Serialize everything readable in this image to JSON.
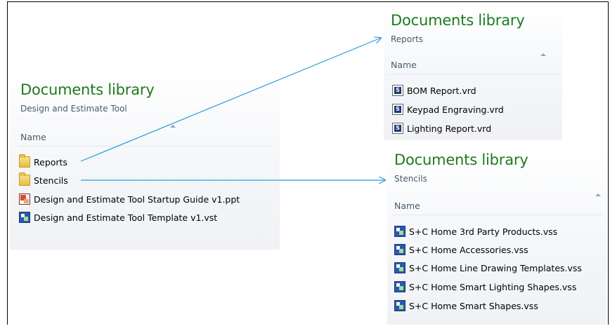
{
  "panels": {
    "main": {
      "title": "Documents library",
      "subtitle": "Design and Estimate Tool",
      "column": "Name",
      "items": [
        {
          "name": "Reports",
          "icon": "folder-icon"
        },
        {
          "name": "Stencils",
          "icon": "folder-icon"
        },
        {
          "name": "Design and Estimate Tool Startup Guide v1.ppt",
          "icon": "powerpoint-file-icon"
        },
        {
          "name": "Design and Estimate Tool Template v1.vst",
          "icon": "visio-template-icon"
        }
      ]
    },
    "reports": {
      "title": "Documents library",
      "subtitle": "Reports",
      "column": "Name",
      "items": [
        {
          "name": "BOM Report.vrd",
          "icon": "report-file-icon"
        },
        {
          "name": "Keypad Engraving.vrd",
          "icon": "report-file-icon"
        },
        {
          "name": "Lighting Report.vrd",
          "icon": "report-file-icon"
        }
      ]
    },
    "stencils": {
      "title": "Documents library",
      "subtitle": "Stencils",
      "column": "Name",
      "items": [
        {
          "name": "S+C Home 3rd Party Products.vss",
          "icon": "visio-stencil-icon"
        },
        {
          "name": "S+C Home Accessories.vss",
          "icon": "visio-stencil-icon"
        },
        {
          "name": "S+C Home Line Drawing Templates.vss",
          "icon": "visio-stencil-icon"
        },
        {
          "name": "S+C Home Smart Lighting Shapes.vss",
          "icon": "visio-stencil-icon"
        },
        {
          "name": "S+C Home Smart Shapes.vss",
          "icon": "visio-stencil-icon"
        }
      ]
    }
  },
  "colors": {
    "title_green": "#1e7a1e",
    "arrow_blue": "#2a9fd8"
  }
}
